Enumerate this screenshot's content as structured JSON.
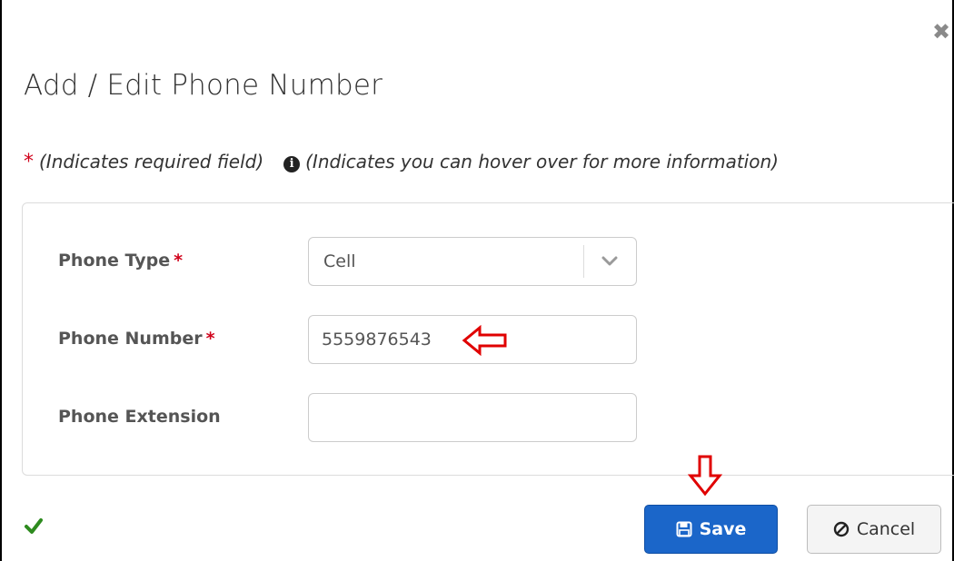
{
  "dialog": {
    "title": "Add / Edit Phone Number",
    "close_symbol": "✖"
  },
  "legend": {
    "required_marker": "*",
    "required_text": "(Indicates required field)",
    "info_icon": "i",
    "info_text": "(Indicates you can hover over for more information)"
  },
  "form": {
    "phone_type": {
      "label": "Phone Type",
      "required_marker": "*",
      "value": "Cell"
    },
    "phone_number": {
      "label": "Phone Number",
      "required_marker": "*",
      "value": "5559876543"
    },
    "phone_extension": {
      "label": "Phone Extension",
      "value": ""
    }
  },
  "footer": {
    "status_icon": "check-icon",
    "save_label": "Save",
    "cancel_label": "Cancel"
  },
  "colors": {
    "required_red": "#d0021b",
    "primary_blue": "#1b66c9",
    "success_green": "#2e8b1f",
    "annotation_red": "#e00000"
  }
}
